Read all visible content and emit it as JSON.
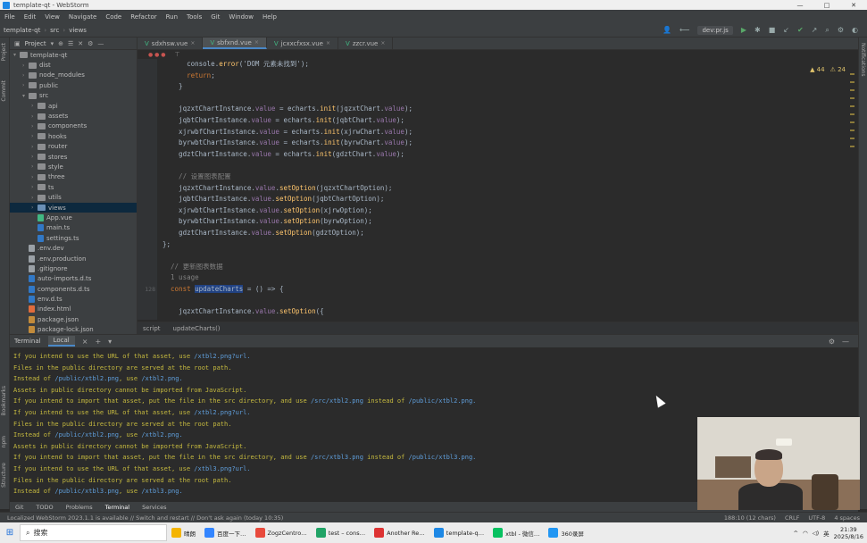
{
  "window": {
    "title": "template-qt - WebStorm",
    "controls": [
      "—",
      "□",
      "✕"
    ]
  },
  "menu": [
    "File",
    "Edit",
    "View",
    "Navigate",
    "Code",
    "Refactor",
    "Run",
    "Tools",
    "Git",
    "Window",
    "Help"
  ],
  "breadcrumbs": [
    "template-qt",
    "src",
    "views"
  ],
  "toolbar": {
    "run_config": "dev:pr.js"
  },
  "project_panel": {
    "label": "Project",
    "tree": [
      {
        "name": "template-qt",
        "kind": "folder-open",
        "depth": 0
      },
      {
        "name": "dist",
        "kind": "folder",
        "depth": 1
      },
      {
        "name": "node_modules",
        "kind": "folder",
        "depth": 1
      },
      {
        "name": "public",
        "kind": "folder",
        "depth": 1
      },
      {
        "name": "src",
        "kind": "folder-open",
        "depth": 1
      },
      {
        "name": "api",
        "kind": "folder",
        "depth": 2
      },
      {
        "name": "assets",
        "kind": "folder",
        "depth": 2
      },
      {
        "name": "components",
        "kind": "folder",
        "depth": 2
      },
      {
        "name": "hooks",
        "kind": "folder",
        "depth": 2
      },
      {
        "name": "router",
        "kind": "folder",
        "depth": 2
      },
      {
        "name": "stores",
        "kind": "folder",
        "depth": 2
      },
      {
        "name": "style",
        "kind": "folder",
        "depth": 2
      },
      {
        "name": "three",
        "kind": "folder",
        "depth": 2
      },
      {
        "name": "ts",
        "kind": "folder",
        "depth": 2
      },
      {
        "name": "utils",
        "kind": "folder",
        "depth": 2
      },
      {
        "name": "views",
        "kind": "folder-sel",
        "depth": 2
      },
      {
        "name": "App.vue",
        "kind": "vue",
        "depth": 2
      },
      {
        "name": "main.ts",
        "kind": "ts",
        "depth": 2
      },
      {
        "name": "settings.ts",
        "kind": "ts",
        "depth": 2
      },
      {
        "name": ".env.dev",
        "kind": "txt",
        "depth": 1
      },
      {
        "name": ".env.production",
        "kind": "txt",
        "depth": 1
      },
      {
        "name": ".gitignore",
        "kind": "txt",
        "depth": 1
      },
      {
        "name": "auto-imports.d.ts",
        "kind": "ts",
        "depth": 1
      },
      {
        "name": "components.d.ts",
        "kind": "ts",
        "depth": 1
      },
      {
        "name": "env.d.ts",
        "kind": "ts",
        "depth": 1
      },
      {
        "name": "index.html",
        "kind": "html",
        "depth": 1
      },
      {
        "name": "package.json",
        "kind": "json",
        "depth": 1
      },
      {
        "name": "package-lock.json",
        "kind": "json",
        "depth": 1
      }
    ]
  },
  "editor": {
    "tabs": [
      {
        "label": "sdxhsw.vue",
        "active": false
      },
      {
        "label": "sbfxnd.vue",
        "active": true
      },
      {
        "label": "jcxxcfxsx.vue",
        "active": false
      },
      {
        "label": "zzcr.vue",
        "active": false
      }
    ],
    "inspections": {
      "warnings": "▲ 44",
      "weak": "⚠ 24"
    },
    "lines": [
      {
        "n": "",
        "text": "      console.error('DOM 元素未找到');"
      },
      {
        "n": "",
        "text": "      return;"
      },
      {
        "n": "",
        "text": "    }"
      },
      {
        "n": "",
        "text": ""
      },
      {
        "n": "",
        "text": "    jqzxtChartInstance.value = echarts.init(jqzxtChart.value);"
      },
      {
        "n": "",
        "text": "    jqbtChartInstance.value = echarts.init(jqbtChart.value);"
      },
      {
        "n": "",
        "text": "    xjrwbfChartInstance.value = echarts.init(xjrwChart.value);"
      },
      {
        "n": "",
        "text": "    byrwbtChartInstance.value = echarts.init(byrwChart.value);"
      },
      {
        "n": "",
        "text": "    gdztChartInstance.value = echarts.init(gdztChart.value);"
      },
      {
        "n": "",
        "text": ""
      },
      {
        "n": "",
        "text": "    // 设置图表配置"
      },
      {
        "n": "",
        "text": "    jqzxtChartInstance.value.setOption(jqzxtChartOption);"
      },
      {
        "n": "",
        "text": "    jqbtChartInstance.value.setOption(jqbtChartOption);"
      },
      {
        "n": "",
        "text": "    xjrwbtChartInstance.value.setOption(xjrwOption);"
      },
      {
        "n": "",
        "text": "    byrwbtChartInstance.value.setOption(byrwOption);"
      },
      {
        "n": "",
        "text": "    gdztChartInstance.value.setOption(gdztOption);"
      },
      {
        "n": "",
        "text": "};"
      },
      {
        "n": "",
        "text": ""
      },
      {
        "n": "",
        "text": "  // 更新图表数据"
      },
      {
        "n": "",
        "text": "  1 usage"
      },
      {
        "n": "128",
        "text": "  const updateCharts = () => {"
      },
      {
        "n": "",
        "text": ""
      },
      {
        "n": "",
        "text": "    jqzxtChartInstance.value.setOption({"
      }
    ],
    "footer": [
      "script",
      "updateCharts()"
    ]
  },
  "terminal": {
    "label": "Terminal",
    "tab": "Local",
    "lines": [
      "If you intend to use the URL of that asset, use /xtbl2.png?url.",
      "Files in the public directory are served at the root path.",
      "Instead of /public/xtbl2.png, use /xtbl2.png.",
      "Assets in public directory cannot be imported from JavaScript.",
      "If you intend to import that asset, put the file in the src directory, and use /src/xtbl2.png instead of /public/xtbl2.png.",
      "If you intend to use the URL of that asset, use /xtbl2.png?url.",
      "Files in the public directory are served at the root path.",
      "Instead of /public/xtbl2.png, use /xtbl2.png.",
      "Assets in public directory cannot be imported from JavaScript.",
      "If you intend to import that asset, put the file in the src directory, and use /src/xtbl3.png instead of /public/xtbl3.png.",
      "If you intend to use the URL of that asset, use /xtbl3.png?url.",
      "Files in the public directory are served at the root path.",
      "Instead of /public/xtbl3.png, use /xtbl3.png."
    ]
  },
  "tool_windows": [
    "Git",
    "TODO",
    "Problems",
    "Terminal",
    "Services"
  ],
  "status": {
    "message": "Localized WebStorm 2023.1.1 is available // Switch and restart // Don't ask again (today 10:35)",
    "position": "188:10 (12 chars)",
    "line_sep": "CRLF",
    "encoding": "UTF-8",
    "indent": "4 spaces"
  },
  "taskbar": {
    "search_placeholder": "搜索",
    "weather": "晴朗",
    "apps": [
      {
        "label": "百度一下…",
        "color": "#3385ff"
      },
      {
        "label": "ZogzCentro…",
        "color": "#e84a3c"
      },
      {
        "label": "test – cons…",
        "color": "#21a366"
      },
      {
        "label": "Another Re…",
        "color": "#d33"
      },
      {
        "label": "template-q…",
        "color": "#1e88e5"
      },
      {
        "label": "xtbl - 微信…",
        "color": "#07c160"
      },
      {
        "label": "360录屏",
        "color": "#2196f3"
      }
    ],
    "ime": "英",
    "time": "21:39",
    "date": "2025/8/16"
  }
}
